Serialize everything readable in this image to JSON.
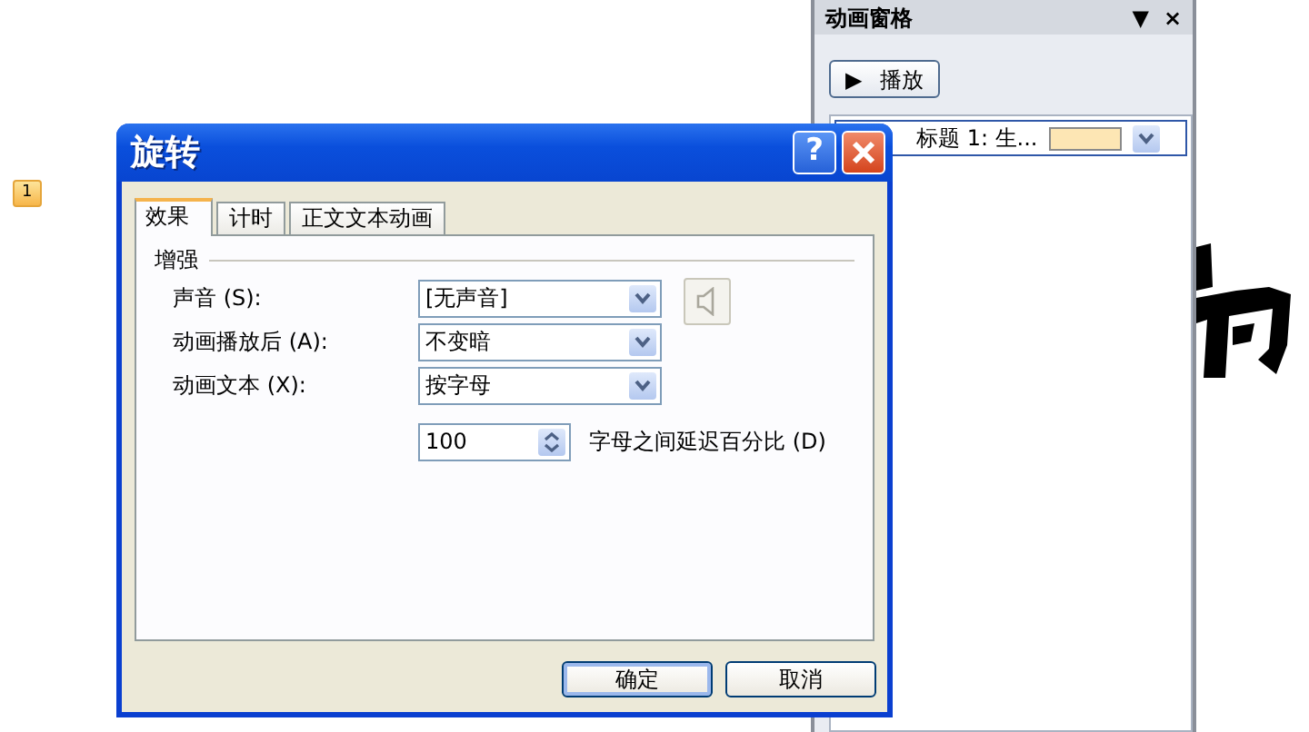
{
  "slide": {
    "slide_number": "1"
  },
  "animation_pane": {
    "title": "动画窗格",
    "menu_glyph": "▼",
    "close_glyph": "×",
    "play_button": {
      "glyph": "▶",
      "label": "播放"
    },
    "items": [
      {
        "label": "标题 1: 生...",
        "color": "#fde6b4",
        "selected": true
      }
    ]
  },
  "dialog": {
    "title": "旋转",
    "help": "?",
    "tabs": [
      {
        "label": "效果",
        "selected": true
      },
      {
        "label": "计时",
        "selected": false
      },
      {
        "label": "正文文本动画",
        "selected": false
      }
    ],
    "group": "增强",
    "fields": [
      {
        "kind": "combo",
        "label": "声音 (S):",
        "value": "[无声音]",
        "sound_button": true
      },
      {
        "kind": "combo",
        "label": "动画播放后 (A):",
        "value": "不变暗",
        "sound_button": false
      },
      {
        "kind": "combo",
        "label": "动画文本 (X):",
        "value": "按字母",
        "sound_button": false
      },
      {
        "kind": "spin",
        "value": "100",
        "label": "字母之间延迟百分比 (D)"
      }
    ],
    "buttons": [
      "确定",
      "取消"
    ]
  }
}
